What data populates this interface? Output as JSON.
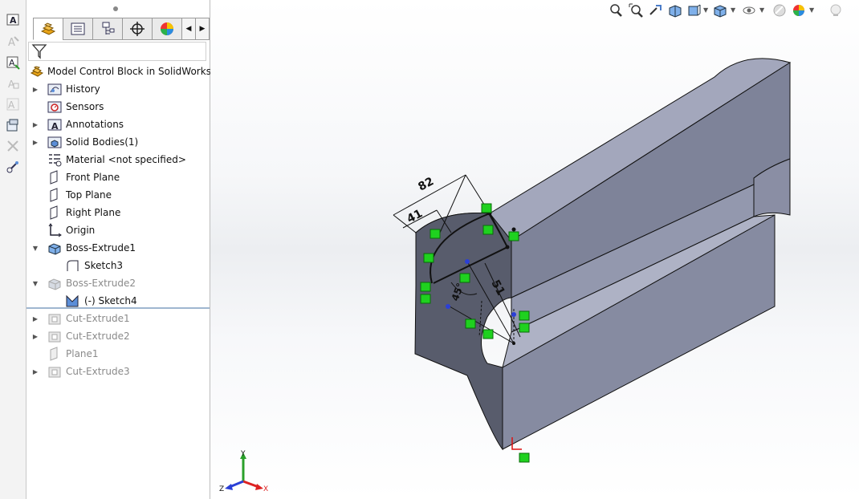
{
  "feature_tree": {
    "root_label": "Model Control Block in SolidWorks  (D",
    "items": [
      {
        "label": "History"
      },
      {
        "label": "Sensors"
      },
      {
        "label": "Annotations"
      },
      {
        "label": "Solid Bodies(1)"
      },
      {
        "label": "Material <not specified>"
      },
      {
        "label": "Front Plane"
      },
      {
        "label": "Top Plane"
      },
      {
        "label": "Right Plane"
      },
      {
        "label": "Origin"
      },
      {
        "label": "Boss-Extrude1"
      },
      {
        "label": "Sketch3"
      },
      {
        "label": "Boss-Extrude2"
      },
      {
        "label": "(-) Sketch4"
      },
      {
        "label": "Cut-Extrude1"
      },
      {
        "label": "Cut-Extrude2"
      },
      {
        "label": "Plane1"
      },
      {
        "label": "Cut-Extrude3"
      }
    ]
  },
  "sketch_dimensions": {
    "d1": "82",
    "d2": "41",
    "d3": "51",
    "d4": "45°"
  },
  "triad": {
    "x": "X",
    "y": "Y",
    "z": "Z"
  },
  "colors": {
    "part_top": "#9da1b5",
    "part_side": "#7a7f96",
    "part_front": "#5a5e6e",
    "relation_green": "#1fd11f",
    "accent_blue": "#2b6cc4"
  }
}
